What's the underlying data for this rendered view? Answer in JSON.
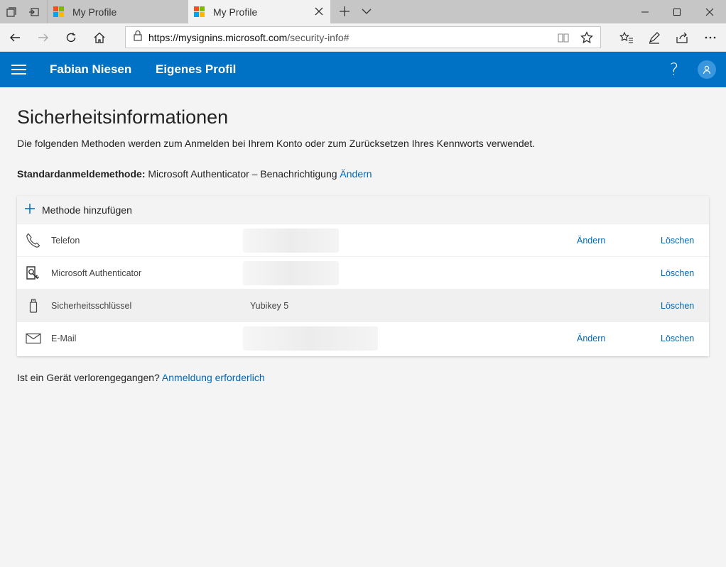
{
  "browser": {
    "tabs": [
      {
        "title": "My Profile",
        "active": false
      },
      {
        "title": "My Profile",
        "active": true
      }
    ],
    "url_host": "https://mysignins.microsoft.com",
    "url_rest": "/security-info#"
  },
  "header": {
    "user_name": "Fabian Niesen",
    "page_name": "Eigenes Profil",
    "help": "?"
  },
  "main": {
    "title": "Sicherheitsinformationen",
    "description": "Die folgenden Methoden werden zum Anmelden bei Ihrem Konto oder zum Zurücksetzen Ihres Kennworts verwendet.",
    "default_label": "Standardanmeldemethode:",
    "default_value": " Microsoft Authenticator – Benachrichtigung ",
    "default_change": "Ändern",
    "add_method": "Methode hinzufügen",
    "methods": [
      {
        "icon": "phone-icon",
        "name": "Telefon",
        "value": "",
        "change": "Ändern",
        "delete": "Löschen"
      },
      {
        "icon": "authenticator-icon",
        "name": "Microsoft Authenticator",
        "value": "",
        "change": "",
        "delete": "Löschen"
      },
      {
        "icon": "security-key-icon",
        "name": "Sicherheitsschlüssel",
        "value": "Yubikey 5",
        "change": "",
        "delete": "Löschen"
      },
      {
        "icon": "email-icon",
        "name": "E-Mail",
        "value": "",
        "change": "Ändern",
        "delete": "Löschen"
      }
    ],
    "lost_device_text": "Ist ein Gerät verlorengegangen? ",
    "lost_device_link": "Anmeldung erforderlich"
  },
  "colors": {
    "accent": "#0072c6",
    "link": "#0067b8"
  }
}
